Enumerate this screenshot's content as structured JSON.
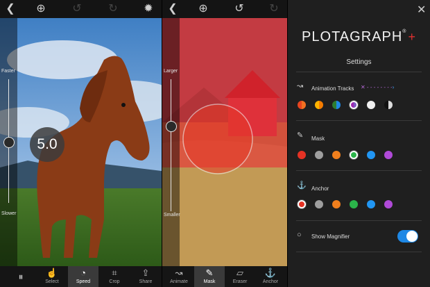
{
  "panel1": {
    "slider_top_label": "Faster",
    "slider_bottom_label": "Slower",
    "speed_value": "5.0",
    "tools": [
      {
        "label": "Select",
        "icon": "hand-icon"
      },
      {
        "label": "Speed",
        "icon": "speedometer-icon"
      },
      {
        "label": "Crop",
        "icon": "crop-icon"
      },
      {
        "label": "Share",
        "icon": "share-icon"
      }
    ]
  },
  "panel2": {
    "slider_top_label": "Larger",
    "slider_bottom_label": "Smaller",
    "tools": [
      {
        "label": "Animate",
        "icon": "animate-icon"
      },
      {
        "label": "Mask",
        "icon": "brush-icon"
      },
      {
        "label": "Eraser",
        "icon": "eraser-icon"
      },
      {
        "label": "Anchor",
        "icon": "anchor-icon"
      }
    ]
  },
  "panel3": {
    "logo": "PLOTAGRAPH",
    "logo_mark": "®",
    "logo_plus": "+",
    "title": "Settings",
    "sections": {
      "animation": {
        "label": "Animation Tracks",
        "swatches": [
          "#e8451f/#f37021",
          "#ffb300/#f57c00",
          "#2e7d32/#1e88e5",
          "#9c27b0/#7e57c2",
          "#f0f0f0/#f0f0f0",
          "#111111/#dddddd"
        ]
      },
      "mask": {
        "label": "Mask",
        "colors": [
          "#e53224",
          "#9e9e9e",
          "#f07f1d",
          "#2bb44a",
          "#2196f3",
          "#b04ad8"
        ],
        "selected_index": 3
      },
      "anchor": {
        "label": "Anchor",
        "colors": [
          "#e53224",
          "#9e9e9e",
          "#f07f1d",
          "#2bb44a",
          "#2196f3",
          "#b04ad8"
        ],
        "selected_index": 0
      },
      "magnifier": {
        "label": "Show Magnifier",
        "on": true
      }
    }
  }
}
